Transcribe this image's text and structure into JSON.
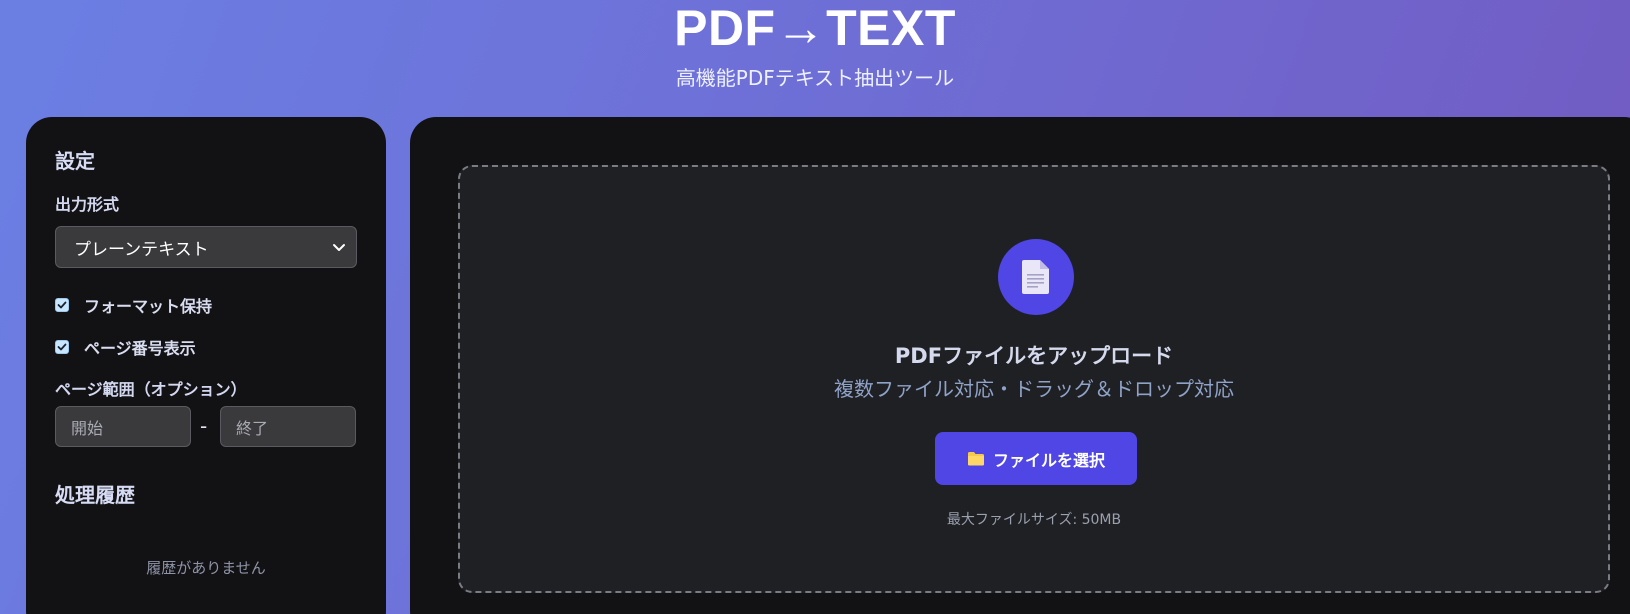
{
  "header": {
    "title": "PDF→TEXT",
    "subtitle": "高機能PDFテキスト抽出ツール"
  },
  "sidebar": {
    "settings_title": "設定",
    "output_format_label": "出力形式",
    "output_format_value": "プレーンテキスト",
    "checkboxes": [
      {
        "label": "フォーマット保持",
        "checked": true
      },
      {
        "label": "ページ番号表示",
        "checked": true
      }
    ],
    "page_range_label": "ページ範囲（オプション）",
    "range_start_placeholder": "開始",
    "range_separator": "-",
    "range_end_placeholder": "終了",
    "history_title": "処理履歴",
    "history_empty": "履歴がありません"
  },
  "upload": {
    "icon": "document-icon",
    "heading": "PDFファイルをアップロード",
    "subheading": "複数ファイル対応・ドラッグ＆ドロップ対応",
    "button_label": "ファイルを選択",
    "button_icon": "folder-icon",
    "max_size": "最大ファイルサイズ: 50MB"
  },
  "colors": {
    "accent": "#4f46e5",
    "panel": "#121214",
    "checkbox": "#c9e6ff"
  }
}
